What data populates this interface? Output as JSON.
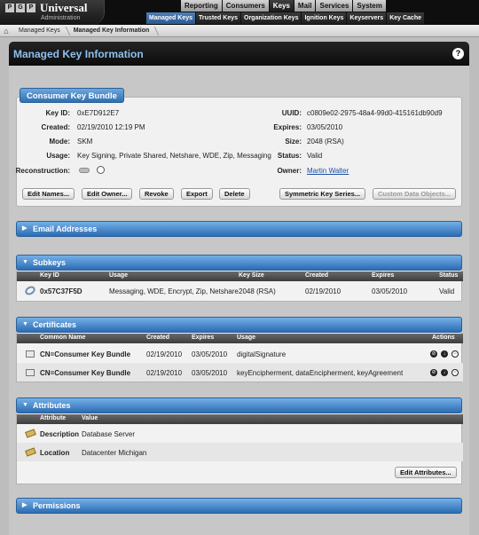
{
  "brand": {
    "letters": [
      "P",
      "G",
      "P"
    ],
    "name": "Universal",
    "sub": "Administration"
  },
  "main_tabs": [
    "Reporting",
    "Consumers",
    "Keys",
    "Mail",
    "Services",
    "System"
  ],
  "sub_tabs": [
    "Managed Keys",
    "Trusted Keys",
    "Organization Keys",
    "Ignition Keys",
    "Keyservers",
    "Key Cache"
  ],
  "breadcrumb": {
    "home_icon": "⌂",
    "items": [
      "Managed Keys",
      "Managed Key Information"
    ]
  },
  "page": {
    "title": "Managed Key Information",
    "help": "?"
  },
  "bundle": {
    "title": "Consumer Key Bundle",
    "fields_left": [
      {
        "label": "Key ID:",
        "value": "0xE7D912E7"
      },
      {
        "label": "Created:",
        "value": "02/19/2010 12:19 PM"
      },
      {
        "label": "Mode:",
        "value": "SKM"
      },
      {
        "label": "Usage:",
        "value": "Key Signing, Private Shared, Netshare, WDE, Zip, Messaging"
      },
      {
        "label": "Reconstruction:",
        "value": ""
      }
    ],
    "fields_right": [
      {
        "label": "UUID:",
        "value": "c0809e02-2975-48a4-99d0-415161db90d9"
      },
      {
        "label": "Expires:",
        "value": "03/05/2010"
      },
      {
        "label": "Size:",
        "value": "2048 (RSA)"
      },
      {
        "label": "Status:",
        "value": "Valid"
      },
      {
        "label": "Owner:",
        "value": "Martin Walter"
      }
    ],
    "buttons": [
      "Edit Names...",
      "Edit Owner...",
      "Revoke",
      "Export",
      "Delete",
      "Symmetric Key Series...",
      "Custom Data Objects..."
    ]
  },
  "sections": {
    "email": "Email Addresses",
    "subkeys": "Subkeys",
    "certificates": "Certificates",
    "attributes": "Attributes",
    "permissions": "Permissions"
  },
  "subkeys": {
    "columns": [
      "Key ID",
      "Usage",
      "Key Size",
      "Created",
      "Expires",
      "Status"
    ],
    "rows": [
      [
        "0x57C37F5D",
        "Messaging, WDE, Encrypt, Zip, Netshare",
        "2048 (RSA)",
        "02/19/2010",
        "03/05/2010",
        "Valid"
      ]
    ]
  },
  "certificates": {
    "columns": [
      "Common Name",
      "Created",
      "Expires",
      "Usage",
      "Actions"
    ],
    "rows": [
      [
        "CN=Consumer Key Bundle",
        "02/19/2010",
        "03/05/2010",
        "digitalSignature"
      ],
      [
        "CN=Consumer Key Bundle",
        "02/19/2010",
        "03/05/2010",
        "keyEncipherment, dataEncipherment, keyAgreement"
      ]
    ]
  },
  "attributes": {
    "columns": [
      "Attribute",
      "Value"
    ],
    "rows": [
      [
        "Description",
        "Database Server"
      ],
      [
        "Location",
        "Datacenter Michigan"
      ]
    ],
    "button": "Edit Attributes..."
  }
}
